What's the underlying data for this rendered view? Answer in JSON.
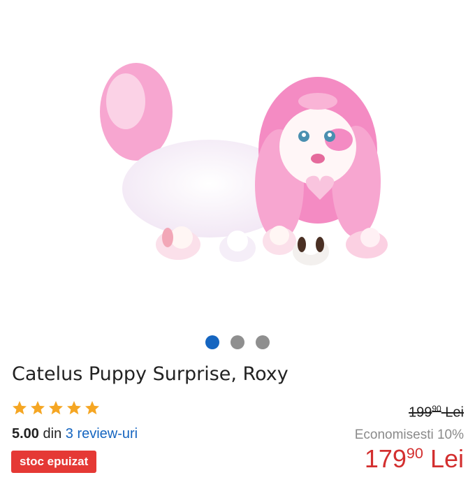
{
  "product": {
    "title": "Catelus Puppy Surprise, Roxy",
    "rating": {
      "stars": 5,
      "score": "5.00",
      "din_label": "din",
      "reviews_link": "3 review-uri"
    },
    "stock_badge": "stoc epuizat",
    "price": {
      "old_integer": "199",
      "old_decimal": "90",
      "old_currency": "Lei",
      "savings": "Economisesti 10%",
      "new_integer": "179",
      "new_decimal": "90",
      "new_currency": "Lei"
    }
  },
  "carousel": {
    "total": 3,
    "active_index": 0
  },
  "colors": {
    "accent_blue": "#1565c0",
    "price_red": "#d32f2f",
    "badge_red": "#e53935",
    "star_gold": "#f5a623"
  }
}
